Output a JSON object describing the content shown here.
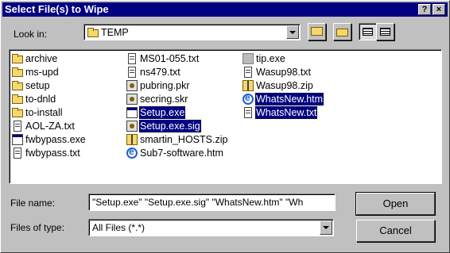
{
  "window": {
    "title": "Select File(s) to Wipe",
    "help_glyph": "?",
    "close_glyph": "×"
  },
  "lookin": {
    "label": "Look in:",
    "value": "TEMP"
  },
  "files": [
    {
      "name": "archive",
      "icon": "folder-icon",
      "selected": false
    },
    {
      "name": "ms-upd",
      "icon": "folder-icon",
      "selected": false
    },
    {
      "name": "setup",
      "icon": "folder-icon",
      "selected": false
    },
    {
      "name": "to-dnld",
      "icon": "folder-icon",
      "selected": false
    },
    {
      "name": "to-install",
      "icon": "folder-icon",
      "selected": false
    },
    {
      "name": "AOL-ZA.txt",
      "icon": "text-file-icon",
      "selected": false
    },
    {
      "name": "fwbypass.exe",
      "icon": "exe-file-icon",
      "selected": false
    },
    {
      "name": "fwbypass.txt",
      "icon": "text-file-icon",
      "selected": false
    },
    {
      "name": "MS01-055.txt",
      "icon": "text-file-icon",
      "selected": false
    },
    {
      "name": "ns479.txt",
      "icon": "text-file-icon",
      "selected": false
    },
    {
      "name": "pubring.pkr",
      "icon": "key-file-icon",
      "selected": false
    },
    {
      "name": "secring.skr",
      "icon": "key-file-icon",
      "selected": false
    },
    {
      "name": "Setup.exe",
      "icon": "exe-file-icon",
      "selected": true
    },
    {
      "name": "Setup.exe.sig",
      "icon": "key-file-icon",
      "selected": true
    },
    {
      "name": "smartin_HOSTS.zip",
      "icon": "zip-file-icon",
      "selected": false
    },
    {
      "name": "Sub7-software.htm",
      "icon": "html-file-icon",
      "selected": false
    },
    {
      "name": "tip.exe",
      "icon": "exe-file-icon",
      "selected": false
    },
    {
      "name": "Wasup98.txt",
      "icon": "text-file-icon",
      "selected": false
    },
    {
      "name": "Wasup98.zip",
      "icon": "zip-file-icon",
      "selected": false
    },
    {
      "name": "WhatsNew.htm",
      "icon": "html-file-icon",
      "selected": true
    },
    {
      "name": "WhatsNew.txt",
      "icon": "text-file-icon",
      "selected": true
    }
  ],
  "filename": {
    "label": "File name:",
    "value": "\"Setup.exe\" \"Setup.exe.sig\" \"WhatsNew.htm\" \"Wh"
  },
  "filetype": {
    "label": "Files of type:",
    "value": "All Files (*.*)"
  },
  "buttons": {
    "open": "Open",
    "cancel": "Cancel"
  }
}
